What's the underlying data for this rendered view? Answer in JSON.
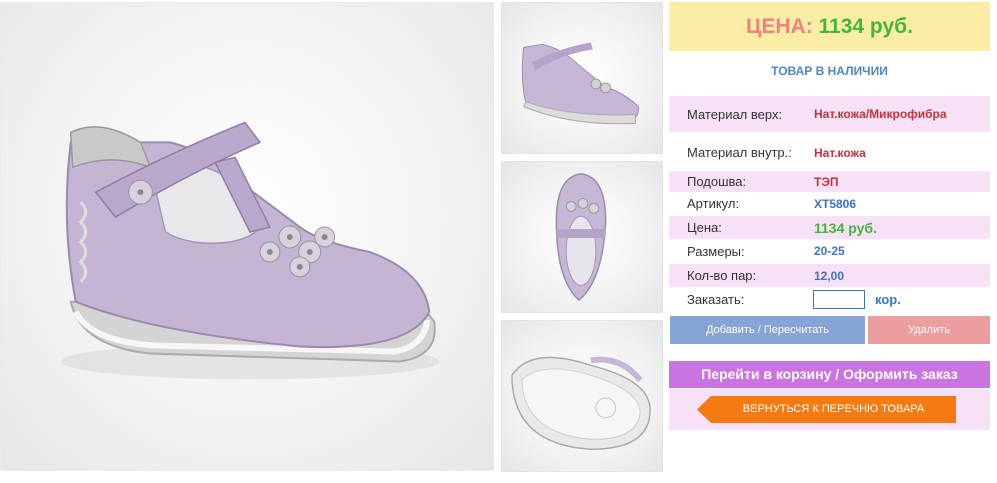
{
  "product": {
    "main_image_icon": "shoe-side-photo",
    "thumbnails": [
      "shoe-side-thumb",
      "shoe-top-thumb",
      "shoe-sole-thumb"
    ]
  },
  "price_box": {
    "label": "ЦЕНА:",
    "value": "1134 руб."
  },
  "stock_status": "ТОВАР В НАЛИЧИИ",
  "specs": [
    {
      "label": "Материал верх:",
      "value": "Нат.кожа/Микрофибра"
    },
    {
      "label": "Материал внутр.:",
      "value": "Нат.кожа"
    },
    {
      "label": "Подошва:",
      "value": "ТЭП"
    },
    {
      "label": "Артикул:",
      "value": "ХТ5806"
    },
    {
      "label": "Цена:",
      "value": "1134 руб."
    },
    {
      "label": "Размеры:",
      "value": "20-25"
    },
    {
      "label": "Кол-во пар:",
      "value": "12,00"
    }
  ],
  "order": {
    "label": "Заказать:",
    "value": "",
    "unit": "кор."
  },
  "buttons": {
    "add": "Добавить / Пересчитать",
    "delete": "Удалить",
    "cart": "Перейти в корзину / Оформить заказ",
    "back": "ВЕРНУТЬСЯ К ПЕРЕЧНЮ ТОВАРА"
  },
  "colors": {
    "price_bg": "#fbeda3",
    "price_label": "#ef8080",
    "price_value": "#44b53b",
    "cart_button": "#cc73e2",
    "back_button": "#f57a12"
  }
}
